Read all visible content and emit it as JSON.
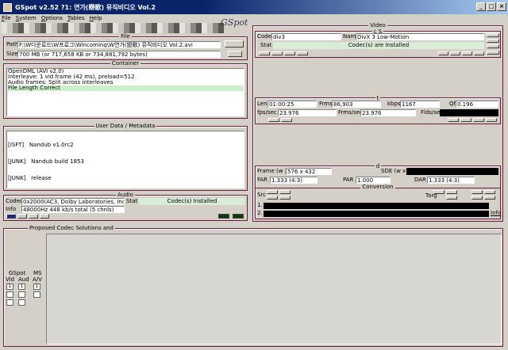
{
  "window": {
    "title": "GSpot v2.52 ?1: 연가(戀歌) 뮤직비디오 Vol.2"
  },
  "menu": [
    "File",
    "System",
    "Options",
    "Tables",
    "Help"
  ],
  "file": {
    "label": "File",
    "path_label": "Path",
    "path": "F:\\W다운로드\\W프로그\\Wincoming\\W연가(戀歌) 뮤직비디오 Vol.2.avi",
    "size_label": "Size",
    "size": "700 MB (or 717,658 KB or 734,881,792 bytes)"
  },
  "container": {
    "label": "Container",
    "lines": [
      "OpenDML (AVI v2.0)",
      "Interleave: 1 vid frame (42 ms), preload=512",
      "Audio frames: Split across interleaves",
      "File Length Correct"
    ]
  },
  "userdata": {
    "label": "User Data / Metadata",
    "lines": [
      "[ISFT]   Nandub v1.0rc2",
      "[JUNK]   Nandub build 1853",
      "[JUNK]   release"
    ]
  },
  "audio": {
    "label": "Audio",
    "codec_label": "Codec",
    "codec": "0x2000(AC3, Dolby Laboratories, Inc) AC3",
    "stat_label": "Stat",
    "stat": "Codec(s) Installed",
    "info_label": "Info",
    "info": "48000Hz  448 kb/s total (5 chnls)"
  },
  "video": {
    "label": "Video",
    "cs_label": "c S",
    "codec_label": "Codec",
    "codec": "div3",
    "name_label": "Name",
    "name": "DivX 3 Low-Motion",
    "stat_label": "Stat",
    "stat": "Codec(s) are Installed"
  },
  "timing": {
    "label": "t",
    "len_label": "Len",
    "len": "01:00:25",
    "frms_label": "Frms",
    "frms": "86,903",
    "kbps_label": "kbps",
    "kbps": "1167",
    "qf_label": "Qf",
    "qf": "0.196",
    "fps_label": "fps/sec",
    "fps": "23.976",
    "frmspsec_label": "Frms/sec",
    "frmspsec": "23.976",
    "flds_label": "Flds/sec",
    "flds": ""
  },
  "dims": {
    "label": "d",
    "frame_label": "Frame (w x h)",
    "frame": "576 x 432",
    "sde_label": "SDE (w x h)",
    "sde": "",
    "far_label": "FAR",
    "far": "1.333 (4:3)",
    "par_label": "PAR",
    "par": "1.000",
    "dar_label": "DAR",
    "dar": "1.333 (4:3)",
    "conversion_label": "Conversion",
    "src_label": "Src",
    "targ_label": "Targ",
    "info_label": "Info"
  },
  "proposed": {
    "label": "Proposed Codec Solutions and",
    "gspot_label": "GSpot",
    "vid_label": "Vid",
    "aud_label": "Aud",
    "ms_label": "MS",
    "av_label": "A/V"
  }
}
